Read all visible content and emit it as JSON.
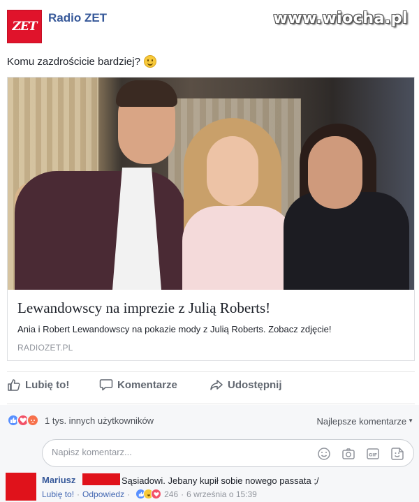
{
  "header": {
    "page_name": "Radio ZET",
    "logo_text": "ZET",
    "watermark": "www.wiocha.pl"
  },
  "post": {
    "text": "Komu zazdrościcie bardziej?",
    "emoji": "smile-emoji"
  },
  "link_card": {
    "title": "Lewandowscy na imprezie z Julią Roberts!",
    "description": "Ania i Robert Lewandowscy na pokazie mody z Julią Roberts. Zobacz zdjęcie!",
    "domain": "RADIOZET.PL"
  },
  "actions": {
    "like": "Lubię to!",
    "comment": "Komentarze",
    "share": "Udostępnij"
  },
  "reactions": {
    "types": [
      "like",
      "love",
      "angry"
    ],
    "summary": "1 tys. innych użytkowników",
    "sort_label": "Najlepsze komentarze"
  },
  "comment_input": {
    "placeholder": "Napisz komentarz..."
  },
  "comments": [
    {
      "author": "Mariusz",
      "text": "Sąsiadowi. Jebany kupił sobie nowego passata ;/",
      "like_label": "Lubię to!",
      "reply_label": "Odpowiedz",
      "reaction_count": "246",
      "timestamp": "6 września o 15:39"
    }
  ],
  "colors": {
    "link_blue": "#365899",
    "brand_red": "#e0132b",
    "muted": "#90949c"
  }
}
